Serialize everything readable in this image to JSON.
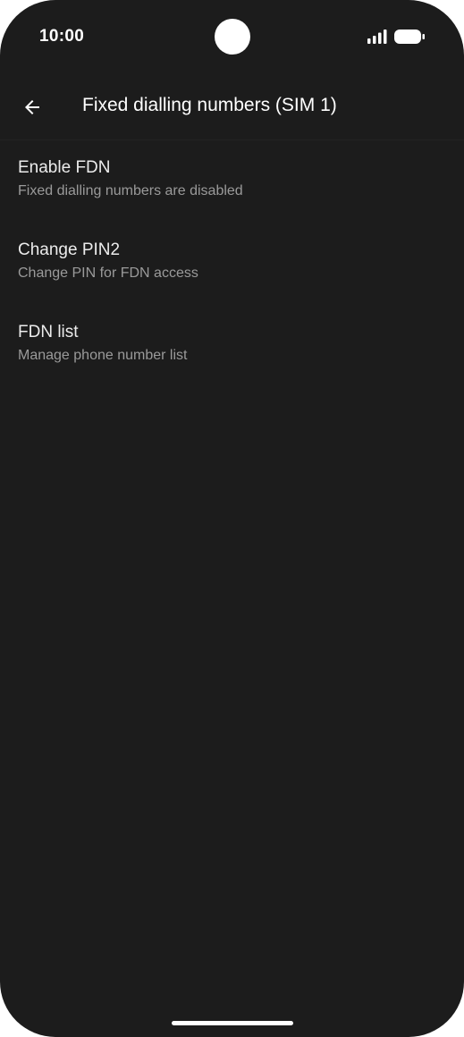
{
  "status_bar": {
    "time": "10:00",
    "signal_icon": "signal-icon",
    "battery_icon": "battery-icon"
  },
  "app_bar": {
    "back_icon": "arrow-back-icon",
    "title": "Fixed dialling numbers (SIM 1)"
  },
  "preferences": [
    {
      "title": "Enable FDN",
      "summary": "Fixed dialling numbers are disabled"
    },
    {
      "title": "Change PIN2",
      "summary": "Change PIN for FDN access"
    },
    {
      "title": "FDN list",
      "summary": "Manage phone number list"
    }
  ],
  "colors": {
    "background": "#1c1c1c",
    "title_text": "#ececec",
    "summary_text": "#9a9a9a"
  }
}
